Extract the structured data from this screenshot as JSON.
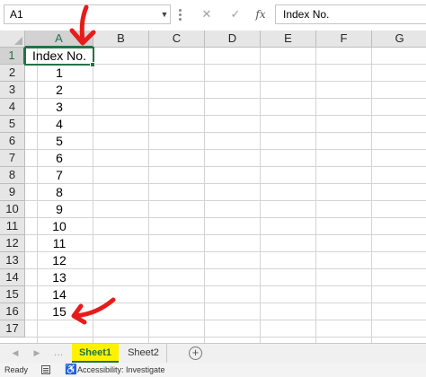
{
  "formula_bar": {
    "name_box": "A1",
    "cancel_glyph": "✕",
    "enter_glyph": "✓",
    "function_label": "fx",
    "formula": "Index No."
  },
  "columns": [
    "A",
    "B",
    "C",
    "D",
    "E",
    "F",
    "G"
  ],
  "rows": [
    "1",
    "2",
    "3",
    "4",
    "5",
    "6",
    "7",
    "8",
    "9",
    "10",
    "11",
    "12",
    "13",
    "14",
    "15",
    "16",
    "17"
  ],
  "cells_A": [
    "Index No.",
    "1",
    "2",
    "3",
    "4",
    "5",
    "6",
    "7",
    "8",
    "9",
    "10",
    "11",
    "12",
    "13",
    "14",
    "15",
    ""
  ],
  "selected_cell": "A1",
  "sheet_tabs": {
    "prev_glyph": "◀",
    "next_glyph": "▶",
    "more_glyph": "…",
    "tabs": [
      {
        "label": "Sheet1",
        "active": true,
        "highlight_color": "#fff200"
      },
      {
        "label": "Sheet2",
        "active": false
      }
    ],
    "add_glyph": "+"
  },
  "status_bar": {
    "ready": "Ready",
    "accessibility": "Accessibility: Investigate"
  },
  "annotations": {
    "arrow_color": "#e81b1b",
    "arrow_targets": [
      "column-A-header",
      "row-16-value"
    ]
  },
  "colors": {
    "accent": "#217346",
    "header_bg": "#e6e6e6",
    "gridline": "#d4d4d4"
  }
}
